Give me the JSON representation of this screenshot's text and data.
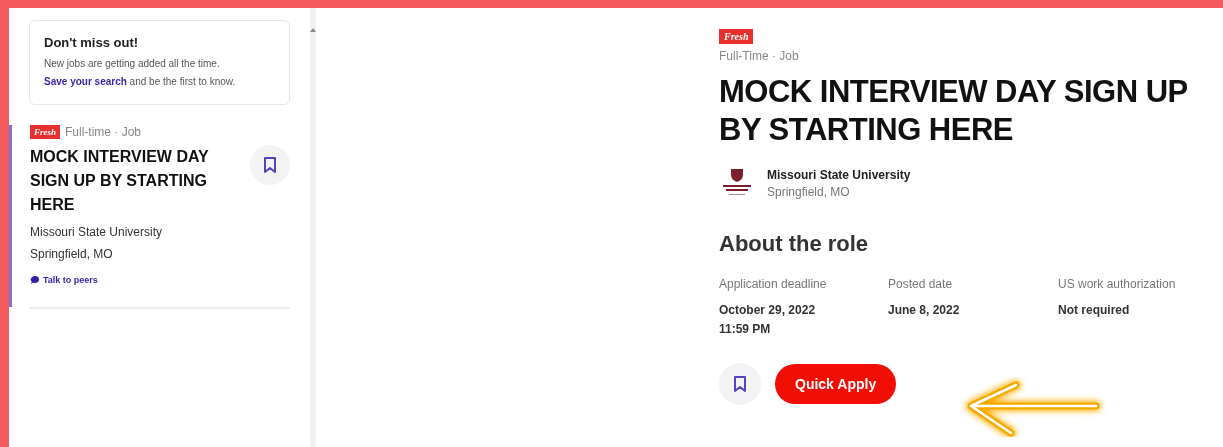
{
  "promo": {
    "title": "Don't miss out!",
    "text": "New jobs are getting added all the time.",
    "link": "Save your search",
    "link_rest": "and be the first to know."
  },
  "job_list": [
    {
      "badge": "Fresh",
      "type": "Full-time · Job",
      "title": "MOCK INTERVIEW DAY SIGN UP BY STARTING HERE",
      "employer": "Missouri State University",
      "location": "Springfield, MO",
      "peers_link": "Talk to peers",
      "selected": true
    }
  ],
  "detail": {
    "badge": "Fresh",
    "type": "Full-Time · Job",
    "title": "MOCK INTERVIEW DAY SIGN UP BY STARTING HERE",
    "employer": "Missouri State University",
    "location": "Springfield, MO",
    "section_title": "About the role",
    "facts": [
      {
        "label": "Application deadline",
        "value": "October 29, 2022\n11:59 PM"
      },
      {
        "label": "Posted date",
        "value": "June 8, 2022"
      },
      {
        "label": "US work authorization",
        "value": "Not required"
      }
    ],
    "apply_button": "Quick Apply"
  }
}
